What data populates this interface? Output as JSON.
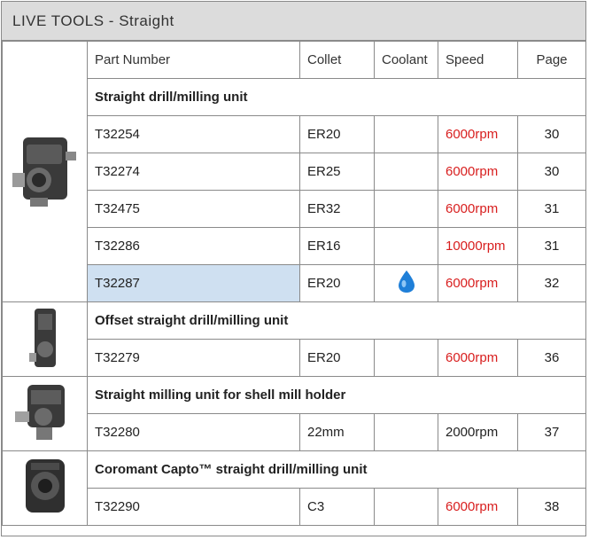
{
  "title": "LIVE TOOLS - Straight",
  "columns": {
    "part": "Part Number",
    "collet": "Collet",
    "coolant": "Coolant",
    "speed": "Speed",
    "page": "Page"
  },
  "groups": [
    {
      "label": "Straight drill/milling unit",
      "rows": [
        {
          "part": "T32254",
          "collet": "ER20",
          "coolant": "",
          "speed": "6000rpm",
          "page": "30"
        },
        {
          "part": "T32274",
          "collet": "ER25",
          "coolant": "",
          "speed": "6000rpm",
          "page": "30"
        },
        {
          "part": "T32475",
          "collet": "ER32",
          "coolant": "",
          "speed": "6000rpm",
          "page": "31"
        },
        {
          "part": "T32286",
          "collet": "ER16",
          "coolant": "",
          "speed": "10000rpm",
          "page": "31"
        },
        {
          "part": "T32287",
          "collet": "ER20",
          "coolant": "coolant-drop-icon",
          "speed": "6000rpm",
          "page": "32"
        }
      ]
    },
    {
      "label": "Offset straight drill/milling unit",
      "rows": [
        {
          "part": "T32279",
          "collet": "ER20",
          "coolant": "",
          "speed": "6000rpm",
          "page": "36"
        }
      ]
    },
    {
      "label": "Straight milling unit for shell mill holder",
      "rows": [
        {
          "part": "T32280",
          "collet": "22mm",
          "coolant": "",
          "speed": "2000rpm",
          "page": "37"
        }
      ]
    },
    {
      "label": "Coromant Capto™ straight drill/milling unit",
      "rows": [
        {
          "part": "T32290",
          "collet": "C3",
          "coolant": "",
          "speed": "6000rpm",
          "page": "38"
        }
      ]
    }
  ],
  "colors": {
    "speed_highlight": "#d81e1e",
    "selected_row": "#cfe0f1",
    "title_bg": "#dcdcdc",
    "coolant_drop": "#1f7fd8"
  }
}
